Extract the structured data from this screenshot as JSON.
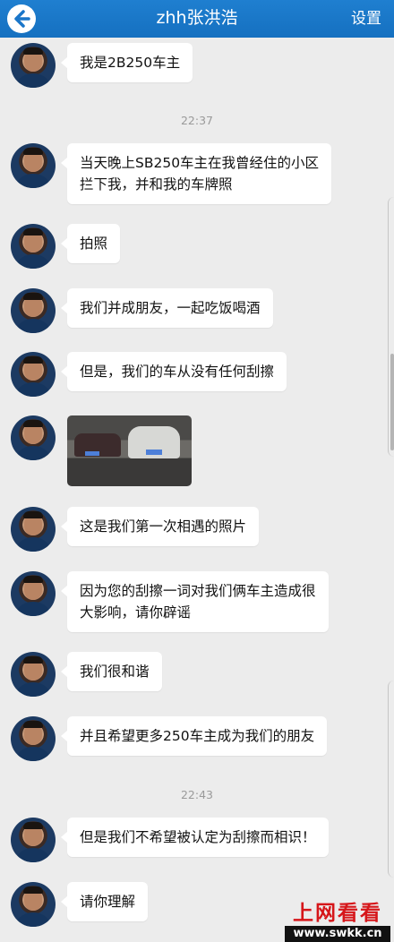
{
  "header": {
    "title": "zhh张洪浩",
    "settings_label": "设置",
    "back_icon": "back-arrow-icon",
    "bar_color": "#1a76c9"
  },
  "messages": [
    {
      "text": "我是2B250车主"
    },
    {
      "text": "当天晚上SB250车主在我曾经住的小区\n拦下我，并和我的车牌照"
    },
    {
      "text": "拍照"
    },
    {
      "text": "我们并成朋友，一起吃饭喝酒"
    },
    {
      "text": "但是，我们的车从没有任何刮擦"
    },
    {
      "image": "photo-two-cars-at-night"
    },
    {
      "text": "这是我们第一次相遇的照片"
    },
    {
      "text": "因为您的刮擦一词对我们俩车主造成很\n大影响，请你辟谣"
    },
    {
      "text": "我们很和谐"
    },
    {
      "text": "并且希望更多250车主成为我们的朋友"
    },
    {
      "text": "但是我们不希望被认定为刮擦而相识！"
    },
    {
      "text": "请你理解"
    }
  ],
  "timestamps": [
    "22:37",
    "22:43"
  ],
  "watermark": {
    "title": "上网看看",
    "url": "www.swkk.cn"
  }
}
